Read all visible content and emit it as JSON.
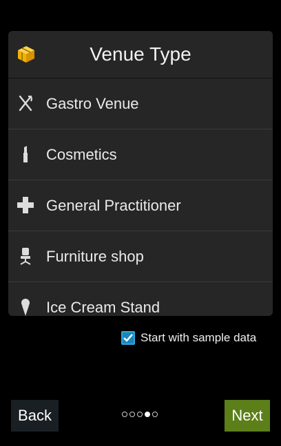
{
  "header": {
    "title": "Venue Type",
    "logo_icon": "cube-icon"
  },
  "venue_types": [
    {
      "label": "Gastro Venue",
      "icon": "fork-knife-icon"
    },
    {
      "label": "Cosmetics",
      "icon": "lipstick-icon"
    },
    {
      "label": "General Practitioner",
      "icon": "medical-cross-icon"
    },
    {
      "label": "Furniture shop",
      "icon": "chair-icon"
    },
    {
      "label": "Ice Cream Stand",
      "icon": "ice-cream-icon"
    }
  ],
  "sample_data": {
    "label": "Start with sample data",
    "checked": true
  },
  "nav": {
    "back_label": "Back",
    "next_label": "Next",
    "page_count": 5,
    "current_page": 4
  },
  "colors": {
    "accent_yellow": "#f0b400",
    "checkbox_blue": "#2ea8e0",
    "next_green": "#5c7f1a",
    "back_dark": "#1a1f24"
  }
}
